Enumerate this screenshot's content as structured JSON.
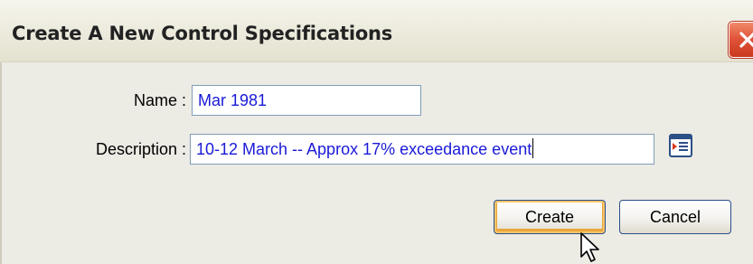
{
  "dialog": {
    "title": "Create A New Control Specifications",
    "close_icon": "close-icon",
    "accent_color": "#e2553a"
  },
  "form": {
    "name_label": "Name :",
    "name_value": "Mar 1981",
    "description_label": "Description :",
    "description_value": "10-12 March -- Approx 17% exceedance event",
    "picker_icon": "list-picker-icon",
    "text_color": "#1a1ad8"
  },
  "buttons": {
    "create_label": "Create",
    "cancel_label": "Cancel"
  },
  "cursor_icon": "mouse-pointer-icon"
}
